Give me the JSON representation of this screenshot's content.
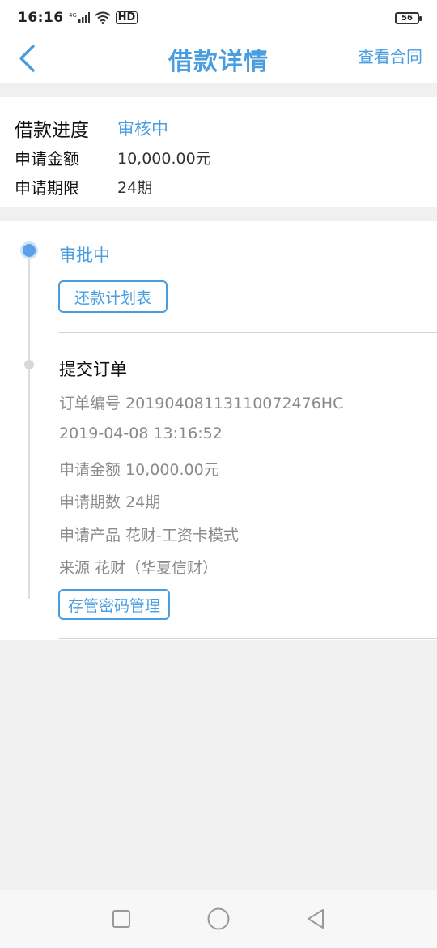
{
  "status_bar": {
    "time": "16:16",
    "network": "4G",
    "hd": "HD",
    "battery": "56"
  },
  "header": {
    "title": "借款详情",
    "action": "查看合同",
    "back_icon": "chevron-left-icon"
  },
  "summary": {
    "progress_label": "借款进度",
    "progress_value": "审核中",
    "amount_label": "申请金额",
    "amount_value": "10,000.00元",
    "term_label": "申请期限",
    "term_value": "24期"
  },
  "timeline": {
    "step1": {
      "status": "审批中",
      "button": "还款计划表"
    },
    "step2": {
      "title": "提交订单",
      "order_no": "订单编号 20190408113110072476HC",
      "time": "2019-04-08 13:16:52",
      "amount": "申请金额 10,000.00元",
      "periods": "申请期数 24期",
      "product": "申请产品 花财-工资卡模式",
      "source": "来源 花财（华夏信财）",
      "button": "存管密码管理"
    }
  },
  "colors": {
    "accent": "#4a9ee0",
    "background": "#f0f0f0"
  }
}
